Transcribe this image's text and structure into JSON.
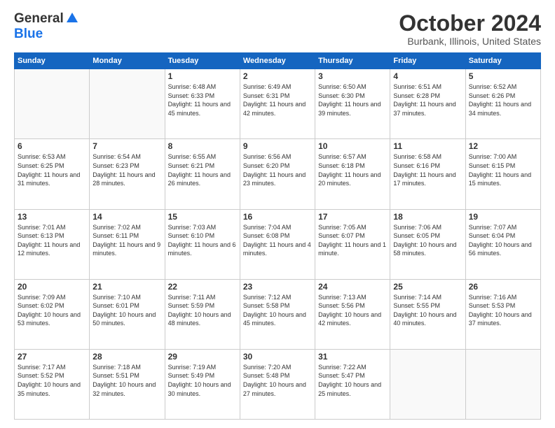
{
  "logo": {
    "line1": "General",
    "line2": "Blue"
  },
  "header": {
    "month_title": "October 2024",
    "location": "Burbank, Illinois, United States"
  },
  "weekdays": [
    "Sunday",
    "Monday",
    "Tuesday",
    "Wednesday",
    "Thursday",
    "Friday",
    "Saturday"
  ],
  "weeks": [
    [
      {
        "day": "",
        "empty": true
      },
      {
        "day": "",
        "empty": true
      },
      {
        "day": "1",
        "sunrise": "6:48 AM",
        "sunset": "6:33 PM",
        "daylight": "11 hours and 45 minutes."
      },
      {
        "day": "2",
        "sunrise": "6:49 AM",
        "sunset": "6:31 PM",
        "daylight": "11 hours and 42 minutes."
      },
      {
        "day": "3",
        "sunrise": "6:50 AM",
        "sunset": "6:30 PM",
        "daylight": "11 hours and 39 minutes."
      },
      {
        "day": "4",
        "sunrise": "6:51 AM",
        "sunset": "6:28 PM",
        "daylight": "11 hours and 37 minutes."
      },
      {
        "day": "5",
        "sunrise": "6:52 AM",
        "sunset": "6:26 PM",
        "daylight": "11 hours and 34 minutes."
      }
    ],
    [
      {
        "day": "6",
        "sunrise": "6:53 AM",
        "sunset": "6:25 PM",
        "daylight": "11 hours and 31 minutes."
      },
      {
        "day": "7",
        "sunrise": "6:54 AM",
        "sunset": "6:23 PM",
        "daylight": "11 hours and 28 minutes."
      },
      {
        "day": "8",
        "sunrise": "6:55 AM",
        "sunset": "6:21 PM",
        "daylight": "11 hours and 26 minutes."
      },
      {
        "day": "9",
        "sunrise": "6:56 AM",
        "sunset": "6:20 PM",
        "daylight": "11 hours and 23 minutes."
      },
      {
        "day": "10",
        "sunrise": "6:57 AM",
        "sunset": "6:18 PM",
        "daylight": "11 hours and 20 minutes."
      },
      {
        "day": "11",
        "sunrise": "6:58 AM",
        "sunset": "6:16 PM",
        "daylight": "11 hours and 17 minutes."
      },
      {
        "day": "12",
        "sunrise": "7:00 AM",
        "sunset": "6:15 PM",
        "daylight": "11 hours and 15 minutes."
      }
    ],
    [
      {
        "day": "13",
        "sunrise": "7:01 AM",
        "sunset": "6:13 PM",
        "daylight": "11 hours and 12 minutes."
      },
      {
        "day": "14",
        "sunrise": "7:02 AM",
        "sunset": "6:11 PM",
        "daylight": "11 hours and 9 minutes."
      },
      {
        "day": "15",
        "sunrise": "7:03 AM",
        "sunset": "6:10 PM",
        "daylight": "11 hours and 6 minutes."
      },
      {
        "day": "16",
        "sunrise": "7:04 AM",
        "sunset": "6:08 PM",
        "daylight": "11 hours and 4 minutes."
      },
      {
        "day": "17",
        "sunrise": "7:05 AM",
        "sunset": "6:07 PM",
        "daylight": "11 hours and 1 minute."
      },
      {
        "day": "18",
        "sunrise": "7:06 AM",
        "sunset": "6:05 PM",
        "daylight": "10 hours and 58 minutes."
      },
      {
        "day": "19",
        "sunrise": "7:07 AM",
        "sunset": "6:04 PM",
        "daylight": "10 hours and 56 minutes."
      }
    ],
    [
      {
        "day": "20",
        "sunrise": "7:09 AM",
        "sunset": "6:02 PM",
        "daylight": "10 hours and 53 minutes."
      },
      {
        "day": "21",
        "sunrise": "7:10 AM",
        "sunset": "6:01 PM",
        "daylight": "10 hours and 50 minutes."
      },
      {
        "day": "22",
        "sunrise": "7:11 AM",
        "sunset": "5:59 PM",
        "daylight": "10 hours and 48 minutes."
      },
      {
        "day": "23",
        "sunrise": "7:12 AM",
        "sunset": "5:58 PM",
        "daylight": "10 hours and 45 minutes."
      },
      {
        "day": "24",
        "sunrise": "7:13 AM",
        "sunset": "5:56 PM",
        "daylight": "10 hours and 42 minutes."
      },
      {
        "day": "25",
        "sunrise": "7:14 AM",
        "sunset": "5:55 PM",
        "daylight": "10 hours and 40 minutes."
      },
      {
        "day": "26",
        "sunrise": "7:16 AM",
        "sunset": "5:53 PM",
        "daylight": "10 hours and 37 minutes."
      }
    ],
    [
      {
        "day": "27",
        "sunrise": "7:17 AM",
        "sunset": "5:52 PM",
        "daylight": "10 hours and 35 minutes."
      },
      {
        "day": "28",
        "sunrise": "7:18 AM",
        "sunset": "5:51 PM",
        "daylight": "10 hours and 32 minutes."
      },
      {
        "day": "29",
        "sunrise": "7:19 AM",
        "sunset": "5:49 PM",
        "daylight": "10 hours and 30 minutes."
      },
      {
        "day": "30",
        "sunrise": "7:20 AM",
        "sunset": "5:48 PM",
        "daylight": "10 hours and 27 minutes."
      },
      {
        "day": "31",
        "sunrise": "7:22 AM",
        "sunset": "5:47 PM",
        "daylight": "10 hours and 25 minutes."
      },
      {
        "day": "",
        "empty": true
      },
      {
        "day": "",
        "empty": true
      }
    ]
  ],
  "labels": {
    "sunrise_prefix": "Sunrise: ",
    "sunset_prefix": "Sunset: ",
    "daylight_prefix": "Daylight: "
  }
}
